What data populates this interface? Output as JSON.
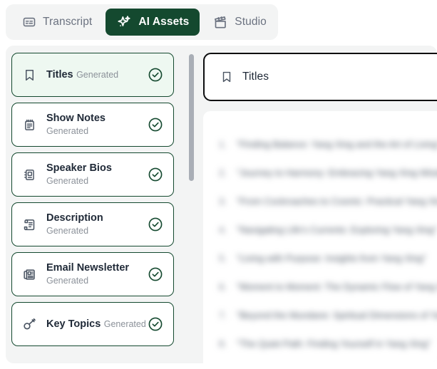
{
  "colors": {
    "brand_dark_green": "#14492f",
    "selected_card_bg": "#eef8f1",
    "panel_bg": "#f3f4f4",
    "card_border": "#14492f",
    "header_border": "#0c0d0e",
    "muted_text": "#8b9199",
    "scrollbar_thumb": "#a9aeb6"
  },
  "tabs": [
    {
      "label": "Transcript",
      "icon": "captions-icon",
      "active": false
    },
    {
      "label": "AI Assets",
      "icon": "sparkles-icon",
      "active": true
    },
    {
      "label": "Studio",
      "icon": "clapperboard-icon",
      "active": false
    }
  ],
  "assets": {
    "status_label": "Generated",
    "items": [
      {
        "title": "Titles",
        "status": "Generated",
        "icon": "bookmark-icon",
        "selected": true,
        "check": "check-circle-icon"
      },
      {
        "title": "Show Notes",
        "status": "Generated",
        "icon": "notepad-icon",
        "selected": false,
        "check": "check-circle-icon"
      },
      {
        "title": "Speaker Bios",
        "status": "Generated",
        "icon": "contact-book-icon",
        "selected": false,
        "check": "check-circle-icon"
      },
      {
        "title": "Description",
        "status": "Generated",
        "icon": "scroll-text-icon",
        "selected": false,
        "check": "check-circle-icon"
      },
      {
        "title": "Email Newsletter",
        "status": "Generated",
        "icon": "newspaper-icon",
        "selected": false,
        "check": "check-circle-icon"
      },
      {
        "title": "Key Topics",
        "status": "Generated",
        "icon": "key-icon",
        "selected": false,
        "check": "check-circle-icon"
      }
    ]
  },
  "detail": {
    "icon": "bookmark-icon",
    "title": "Titles",
    "items": [
      {
        "num": "1.",
        "text": "\"Finding Balance: Yang Xing and the Art of Living\""
      },
      {
        "num": "2.",
        "text": "\"Journey to Harmony: Embracing Yang Xing Wisdom\""
      },
      {
        "num": "3.",
        "text": "\"From Cockroaches to Cosmic: Practical Yang Xing\""
      },
      {
        "num": "4.",
        "text": "\"Navigating Life's Currents: Exploring Yang Xing\""
      },
      {
        "num": "5.",
        "text": "\"Living with Purpose: Insights from Yang Xing\""
      },
      {
        "num": "6.",
        "text": "\"Moment to Moment: The Dynamic Flow of Yang Xing\""
      },
      {
        "num": "7.",
        "text": "\"Beyond the Mundane: Spiritual Dimensions of Yang Xing\""
      },
      {
        "num": "8.",
        "text": "\"The Quiet Path: Finding Yourself in Yang Xing\""
      }
    ]
  }
}
